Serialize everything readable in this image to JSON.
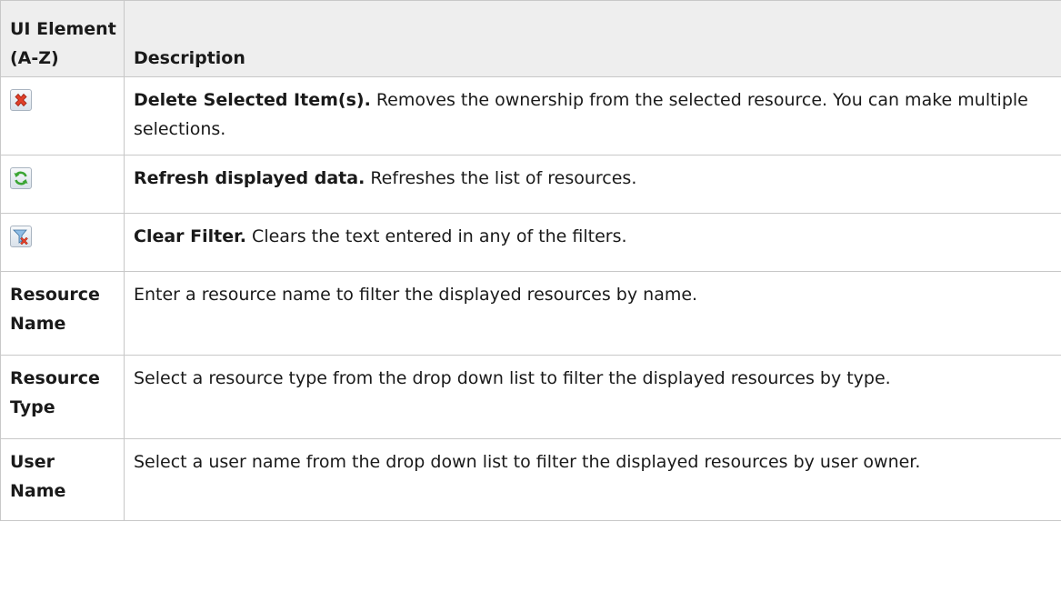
{
  "table": {
    "header": {
      "col1_line1": "UI Element",
      "col1_line2": "(A-Z)",
      "col2": "Description"
    },
    "rows": [
      {
        "icon": "delete-icon",
        "title": "Delete Selected Item(s).",
        "text": " Removes the ownership from the selected resource. You can make multiple selections."
      },
      {
        "icon": "refresh-icon",
        "title": "Refresh displayed data.",
        "text": " Refreshes the list of resources."
      },
      {
        "icon": "clear-filter-icon",
        "title": "Clear Filter.",
        "text": " Clears the text entered in any of the filters."
      },
      {
        "label_line1": "Resource",
        "label_line2": "Name",
        "text": "Enter a resource name to filter the displayed resources by name."
      },
      {
        "label_line1": "Resource",
        "label_line2": "Type",
        "text": "Select a resource type from the drop down list to filter the displayed resources by type."
      },
      {
        "label": "User Name",
        "text": "Select a user name from the drop down list to filter the displayed resources by user owner."
      }
    ]
  },
  "colors": {
    "header_bg": "#eeeeee",
    "border": "#c8c8c8",
    "delete_red": "#e0402a",
    "refresh_green": "#3aa534",
    "filter_blue": "#4a8fc8"
  }
}
